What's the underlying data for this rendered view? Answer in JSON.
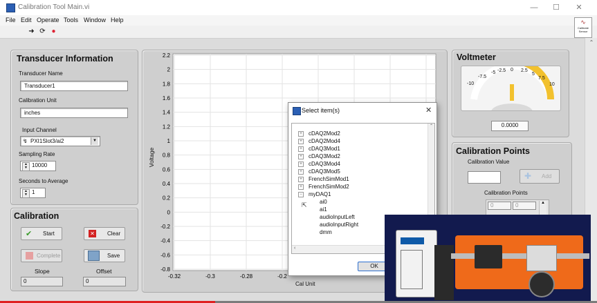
{
  "window": {
    "title": "Calibration Tool Main.vi"
  },
  "menu": [
    "File",
    "Edit",
    "Operate",
    "Tools",
    "Window",
    "Help"
  ],
  "side_label": "Calibrate Sensor",
  "transducer": {
    "title": "Transducer Information",
    "name_label": "Transducer Name",
    "name_value": "Transducer1",
    "unit_label": "Calibration Unit",
    "unit_value": "inches",
    "channel_label": "Input Channel",
    "channel_value": "PXI1Slot3/ai2",
    "rate_label": "Sampling Rate",
    "rate_value": "10000",
    "seconds_label": "Seconds to Average",
    "seconds_value": "1"
  },
  "calibration": {
    "title": "Calibration",
    "start": "Start",
    "clear": "Clear",
    "complete": "Complete",
    "save": "Save",
    "slope_label": "Slope",
    "slope_value": "0",
    "offset_label": "Offset",
    "offset_value": "0"
  },
  "chart": {
    "ylabel": "Voltage",
    "xlabel": "Cal Unit",
    "yticks": [
      "2.2",
      "2",
      "1.8",
      "1.6",
      "1.4",
      "1.2",
      "1",
      "0.8",
      "0.6",
      "0.4",
      "0.2",
      "0",
      "-0.2",
      "-0.4",
      "-0.6",
      "-0.8"
    ],
    "xticks": [
      "-0.32",
      "-0.3",
      "-0.28",
      "-0.2"
    ]
  },
  "voltmeter": {
    "title": "Voltmeter",
    "scale": [
      "-10",
      "-7.5",
      "-5",
      "-2.5",
      "0",
      "2.5",
      "5",
      "7.5",
      "10"
    ],
    "reading": "0.0000"
  },
  "cal_points": {
    "title": "Calibration Points",
    "value_label": "Calibration Value",
    "add": "Add",
    "points_label": "Calibration Points",
    "cell1": "0",
    "cell2": "0"
  },
  "dialog": {
    "title": "Select item(s)",
    "items": [
      "cDAQ2Mod2",
      "cDAQ2Mod4",
      "cDAQ3Mod1",
      "cDAQ3Mod2",
      "cDAQ3Mod4",
      "cDAQ3Mod5",
      "FrenchSimMod1",
      "FrenchSimMod2",
      "myDAQ1"
    ],
    "children": [
      "ai0",
      "ai1",
      "audioInputLeft",
      "audioInputRight",
      "dmm"
    ],
    "ok": "OK"
  },
  "colors": {
    "accent_yellow": "#f2c12e",
    "progress_red": "#e02020"
  }
}
